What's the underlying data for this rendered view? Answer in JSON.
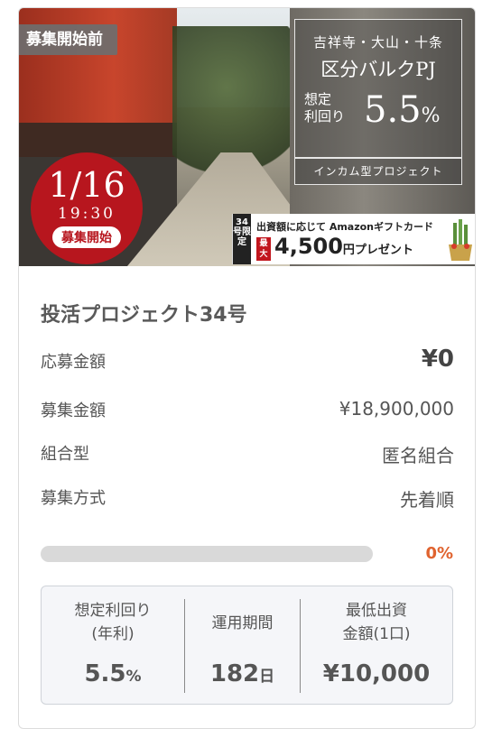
{
  "hero": {
    "status_tag": "募集開始前",
    "date": "1/16",
    "time": "19:30",
    "start_label": "募集開始",
    "promo": {
      "location": "吉祥寺・大山・十条",
      "project_name": "区分バルクPJ",
      "yield_label_1": "想定",
      "yield_label_2": "利回り",
      "yield_value": "5.5",
      "yield_unit": "%",
      "type": "インカム型プロジェクト"
    },
    "gift": {
      "limit_label": "34号限定",
      "headline": "出資額に応じて Amazonギフトカード",
      "max_label": "最大",
      "amount": "4,500",
      "amount_suffix": "円プレゼント"
    }
  },
  "project": {
    "title": "投活プロジェクト34号",
    "rows": [
      {
        "label": "応募金額",
        "value": "¥0"
      },
      {
        "label": "募集金額",
        "value": "¥18,900,000"
      },
      {
        "label": "組合型",
        "value": "匿名組合"
      },
      {
        "label": "募集方式",
        "value": "先着順"
      }
    ],
    "progress_label": "0%",
    "progress_fraction": 0
  },
  "summary": {
    "yield_label_1": "想定利回り",
    "yield_label_2": "(年利)",
    "yield_value": "5.5",
    "yield_unit": "%",
    "period_label": "運用期間",
    "period_value": "182",
    "period_unit": "日",
    "min_label_1": "最低出資",
    "min_label_2": "金額(1口)",
    "min_value": "¥10,000"
  },
  "colors": {
    "accent": "#e0632f",
    "badge_red": "#b7161e",
    "panel_bg": "#f5f6f9"
  }
}
